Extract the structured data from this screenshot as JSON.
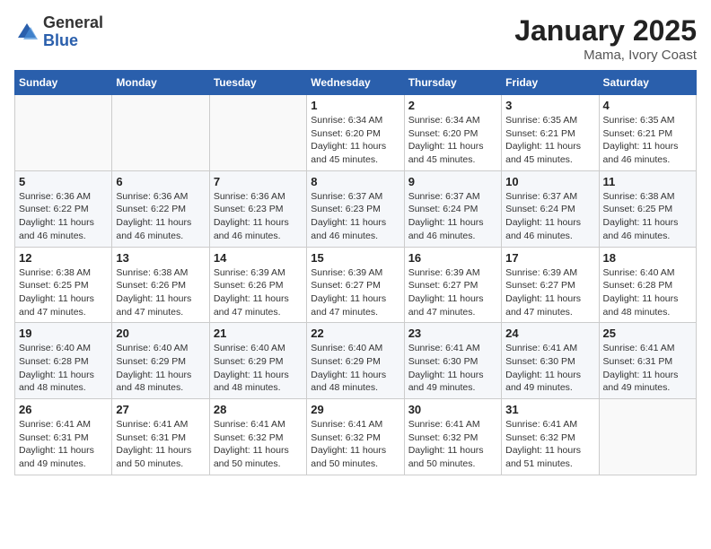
{
  "header": {
    "logo_general": "General",
    "logo_blue": "Blue",
    "month_title": "January 2025",
    "location": "Mama, Ivory Coast"
  },
  "days_of_week": [
    "Sunday",
    "Monday",
    "Tuesday",
    "Wednesday",
    "Thursday",
    "Friday",
    "Saturday"
  ],
  "weeks": [
    [
      {
        "day": "",
        "info": ""
      },
      {
        "day": "",
        "info": ""
      },
      {
        "day": "",
        "info": ""
      },
      {
        "day": "1",
        "info": "Sunrise: 6:34 AM\nSunset: 6:20 PM\nDaylight: 11 hours\nand 45 minutes."
      },
      {
        "day": "2",
        "info": "Sunrise: 6:34 AM\nSunset: 6:20 PM\nDaylight: 11 hours\nand 45 minutes."
      },
      {
        "day": "3",
        "info": "Sunrise: 6:35 AM\nSunset: 6:21 PM\nDaylight: 11 hours\nand 45 minutes."
      },
      {
        "day": "4",
        "info": "Sunrise: 6:35 AM\nSunset: 6:21 PM\nDaylight: 11 hours\nand 46 minutes."
      }
    ],
    [
      {
        "day": "5",
        "info": "Sunrise: 6:36 AM\nSunset: 6:22 PM\nDaylight: 11 hours\nand 46 minutes."
      },
      {
        "day": "6",
        "info": "Sunrise: 6:36 AM\nSunset: 6:22 PM\nDaylight: 11 hours\nand 46 minutes."
      },
      {
        "day": "7",
        "info": "Sunrise: 6:36 AM\nSunset: 6:23 PM\nDaylight: 11 hours\nand 46 minutes."
      },
      {
        "day": "8",
        "info": "Sunrise: 6:37 AM\nSunset: 6:23 PM\nDaylight: 11 hours\nand 46 minutes."
      },
      {
        "day": "9",
        "info": "Sunrise: 6:37 AM\nSunset: 6:24 PM\nDaylight: 11 hours\nand 46 minutes."
      },
      {
        "day": "10",
        "info": "Sunrise: 6:37 AM\nSunset: 6:24 PM\nDaylight: 11 hours\nand 46 minutes."
      },
      {
        "day": "11",
        "info": "Sunrise: 6:38 AM\nSunset: 6:25 PM\nDaylight: 11 hours\nand 46 minutes."
      }
    ],
    [
      {
        "day": "12",
        "info": "Sunrise: 6:38 AM\nSunset: 6:25 PM\nDaylight: 11 hours\nand 47 minutes."
      },
      {
        "day": "13",
        "info": "Sunrise: 6:38 AM\nSunset: 6:26 PM\nDaylight: 11 hours\nand 47 minutes."
      },
      {
        "day": "14",
        "info": "Sunrise: 6:39 AM\nSunset: 6:26 PM\nDaylight: 11 hours\nand 47 minutes."
      },
      {
        "day": "15",
        "info": "Sunrise: 6:39 AM\nSunset: 6:27 PM\nDaylight: 11 hours\nand 47 minutes."
      },
      {
        "day": "16",
        "info": "Sunrise: 6:39 AM\nSunset: 6:27 PM\nDaylight: 11 hours\nand 47 minutes."
      },
      {
        "day": "17",
        "info": "Sunrise: 6:39 AM\nSunset: 6:27 PM\nDaylight: 11 hours\nand 47 minutes."
      },
      {
        "day": "18",
        "info": "Sunrise: 6:40 AM\nSunset: 6:28 PM\nDaylight: 11 hours\nand 48 minutes."
      }
    ],
    [
      {
        "day": "19",
        "info": "Sunrise: 6:40 AM\nSunset: 6:28 PM\nDaylight: 11 hours\nand 48 minutes."
      },
      {
        "day": "20",
        "info": "Sunrise: 6:40 AM\nSunset: 6:29 PM\nDaylight: 11 hours\nand 48 minutes."
      },
      {
        "day": "21",
        "info": "Sunrise: 6:40 AM\nSunset: 6:29 PM\nDaylight: 11 hours\nand 48 minutes."
      },
      {
        "day": "22",
        "info": "Sunrise: 6:40 AM\nSunset: 6:29 PM\nDaylight: 11 hours\nand 48 minutes."
      },
      {
        "day": "23",
        "info": "Sunrise: 6:41 AM\nSunset: 6:30 PM\nDaylight: 11 hours\nand 49 minutes."
      },
      {
        "day": "24",
        "info": "Sunrise: 6:41 AM\nSunset: 6:30 PM\nDaylight: 11 hours\nand 49 minutes."
      },
      {
        "day": "25",
        "info": "Sunrise: 6:41 AM\nSunset: 6:31 PM\nDaylight: 11 hours\nand 49 minutes."
      }
    ],
    [
      {
        "day": "26",
        "info": "Sunrise: 6:41 AM\nSunset: 6:31 PM\nDaylight: 11 hours\nand 49 minutes."
      },
      {
        "day": "27",
        "info": "Sunrise: 6:41 AM\nSunset: 6:31 PM\nDaylight: 11 hours\nand 50 minutes."
      },
      {
        "day": "28",
        "info": "Sunrise: 6:41 AM\nSunset: 6:32 PM\nDaylight: 11 hours\nand 50 minutes."
      },
      {
        "day": "29",
        "info": "Sunrise: 6:41 AM\nSunset: 6:32 PM\nDaylight: 11 hours\nand 50 minutes."
      },
      {
        "day": "30",
        "info": "Sunrise: 6:41 AM\nSunset: 6:32 PM\nDaylight: 11 hours\nand 50 minutes."
      },
      {
        "day": "31",
        "info": "Sunrise: 6:41 AM\nSunset: 6:32 PM\nDaylight: 11 hours\nand 51 minutes."
      },
      {
        "day": "",
        "info": ""
      }
    ]
  ]
}
